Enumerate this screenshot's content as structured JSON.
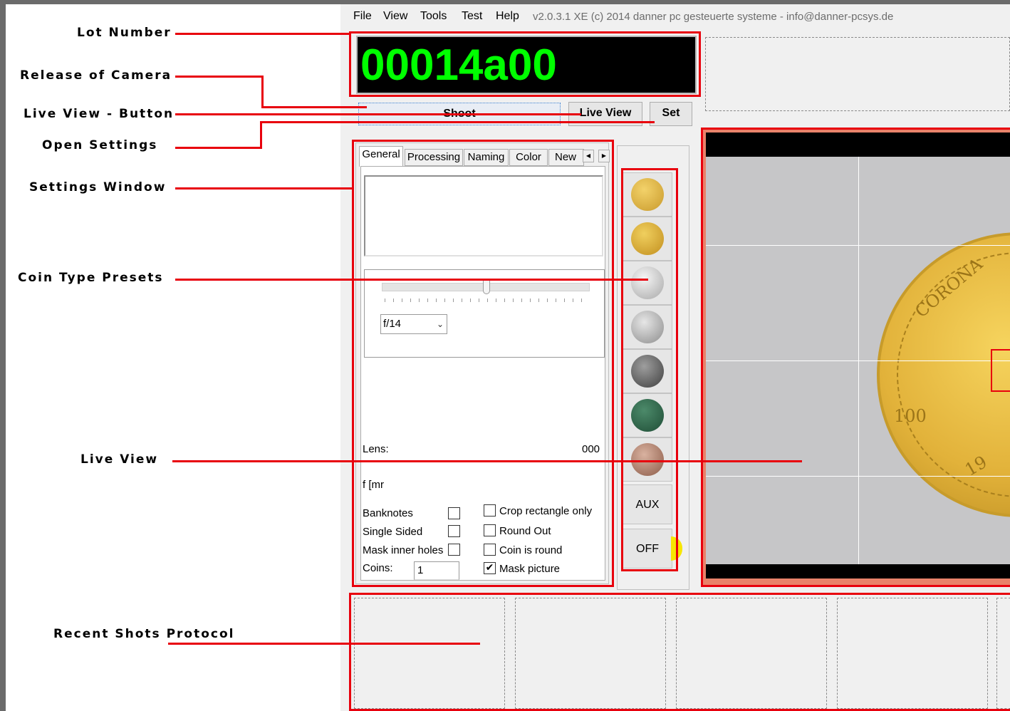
{
  "annotations": {
    "lot_number": "Lot Number",
    "release_camera": "Release of Camera",
    "live_view_button": "Live View - Button",
    "open_settings": "Open Settings",
    "settings_window": "Settings Window",
    "coin_type_presets": "Coin Type Presets",
    "live_view": "Live View",
    "recent_shots": "Recent Shots Protocol"
  },
  "menu": {
    "items": [
      "File",
      "View",
      "Tools",
      "Test",
      "Help"
    ],
    "version": "v2.0.3.1 XE (c) 2014 danner pc gesteuerte systeme   -   info@danner-pcsys.de"
  },
  "lot": {
    "value": "00014a00"
  },
  "buttons": {
    "shoot": "Shoot",
    "live_view": "Live View",
    "set": "Set"
  },
  "tabs": [
    "General",
    "Processing",
    "Naming",
    "Color",
    "New F"
  ],
  "aperture": {
    "selected": "f/14"
  },
  "lens": {
    "label": "Lens:",
    "value": "000"
  },
  "focal": {
    "label": "f [mr"
  },
  "options": {
    "banknotes": "Banknotes",
    "single_sided": "Single Sided",
    "mask_inner_holes": "Mask inner holes",
    "coins_label": "Coins:",
    "coins_value": "1",
    "crop_rect_only": "Crop rectangle only",
    "round_out": "Round Out",
    "coin_is_round": "Coin is round",
    "mask_picture": "Mask picture",
    "mask_picture_checked": "✔"
  },
  "presets": {
    "aux": "AUX",
    "off": "OFF"
  },
  "coin_icons": [
    "coin-gold-brandenburg-gate-icon",
    "coin-gold-ornate-icon",
    "coin-silver-eagle-icon",
    "coin-silver-portrait-icon",
    "coin-dark-portrait-icon",
    "coin-green-bronze-icon",
    "coin-copper-icon"
  ],
  "liveview": {
    "coin_texts": [
      "CORONA",
      "100",
      "19"
    ]
  },
  "colors": {
    "accent": "#e8000d",
    "lot_text": "#00ff00",
    "led": "#f7e600"
  }
}
